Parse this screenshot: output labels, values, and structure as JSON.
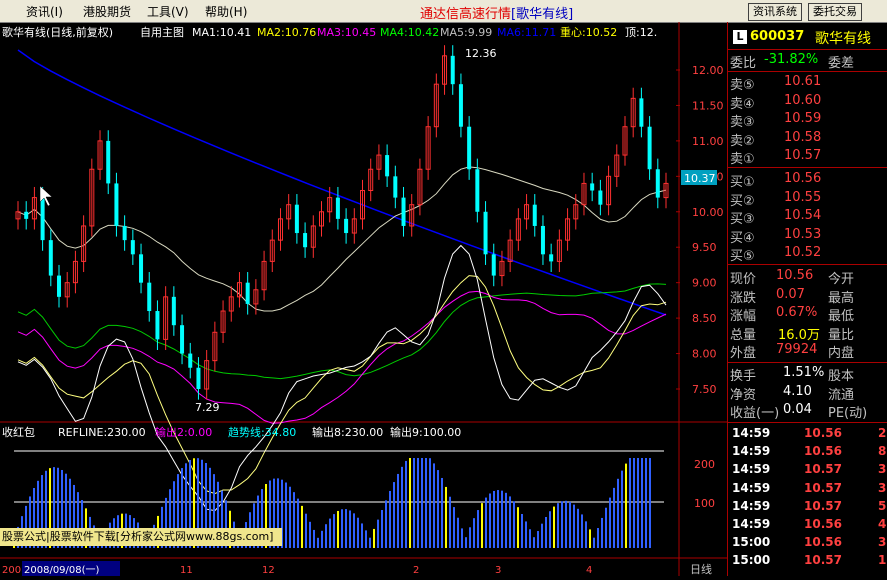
{
  "menu": {
    "items": [
      "资讯(I)",
      "港股期货",
      "工具(V)",
      "帮助(H)"
    ],
    "title": "通达信高速行情",
    "subtitle": "[歌华有线]",
    "btn_news": "资讯系统",
    "btn_trade": "委托交易"
  },
  "main_chart": {
    "header": [
      "歌华有线(日线,前复权)",
      "自用主图",
      "MA1:10.41",
      "MA2:10.76",
      "MA3:10.45",
      "MA4:10.42",
      "MA5:9.99",
      "MA6:11.71",
      "重心:10.52",
      "顶:12."
    ],
    "header_colors": [
      "#ffffff",
      "#ffffff",
      "#ffffff",
      "#ffff00",
      "#ff00ff",
      "#00ff00",
      "#c0c0c0",
      "#0000ff",
      "#ffff00",
      "#ffffff"
    ],
    "price_labels": [
      "12.00",
      "11.50",
      "11.00",
      "10.50",
      "10.00",
      "9.50",
      "9.00",
      "8.50",
      "8.00",
      "7.50"
    ],
    "high_label": "12.36",
    "low_label": "7.29",
    "current_price_tag": "10.37"
  },
  "chart_data": {
    "type": "candlestick",
    "yaxis_labels": [
      12.0,
      11.5,
      11.0,
      10.5,
      10.0,
      9.5,
      9.0,
      8.5,
      8.0,
      7.5
    ],
    "high": 12.36,
    "low": 7.29,
    "last_close": 10.37,
    "closes": [
      10.0,
      9.9,
      10.2,
      9.6,
      9.1,
      8.8,
      9.0,
      9.3,
      9.8,
      10.6,
      11.0,
      10.4,
      9.8,
      9.6,
      9.4,
      9.0,
      8.6,
      8.2,
      8.8,
      8.4,
      8.0,
      7.8,
      7.5,
      7.9,
      8.3,
      8.6,
      8.8,
      9.0,
      8.7,
      8.9,
      9.3,
      9.6,
      9.9,
      10.1,
      9.7,
      9.5,
      9.8,
      10.0,
      10.2,
      9.9,
      9.7,
      9.9,
      10.3,
      10.6,
      10.8,
      10.5,
      10.2,
      9.8,
      10.1,
      10.6,
      11.2,
      11.8,
      12.2,
      11.8,
      11.2,
      10.6,
      10.0,
      9.4,
      9.1,
      9.3,
      9.6,
      9.9,
      10.1,
      9.8,
      9.4,
      9.3,
      9.6,
      9.9,
      10.1,
      10.4,
      10.3,
      10.1,
      10.5,
      10.8,
      11.2,
      11.6,
      11.2,
      10.6,
      10.2,
      10.4
    ],
    "indicator": {
      "title": "收红包",
      "refline": "REFLINE:230.00",
      "out2": "输出2:0.00",
      "trend": "趋势线:34.80",
      "out8": "输出8:230.00",
      "out9": "输出9:100.00",
      "axis": [
        200.0,
        100.0
      ]
    }
  },
  "bottom": {
    "label_200": "200",
    "date": "2008/09/08(一)",
    "ticks": [
      "11",
      "12",
      "2",
      "3",
      "4"
    ],
    "period": "日线"
  },
  "quote": {
    "code": "600037",
    "name": "歌华有线",
    "weibi_label": "委比",
    "weibi_value": "-31.82%",
    "weicha_label": "委差",
    "sell": [
      {
        "label": "卖⑤",
        "price": "10.61"
      },
      {
        "label": "卖④",
        "price": "10.60"
      },
      {
        "label": "卖③",
        "price": "10.59"
      },
      {
        "label": "卖②",
        "price": "10.58"
      },
      {
        "label": "卖①",
        "price": "10.57"
      }
    ],
    "buy": [
      {
        "label": "买①",
        "price": "10.56"
      },
      {
        "label": "买②",
        "price": "10.55"
      },
      {
        "label": "买③",
        "price": "10.54"
      },
      {
        "label": "买④",
        "price": "10.53"
      },
      {
        "label": "买⑤",
        "price": "10.52"
      }
    ],
    "stats": [
      {
        "label": "现价",
        "value": "10.56",
        "label2": "今开"
      },
      {
        "label": "涨跌",
        "value": "0.07",
        "label2": "最高"
      },
      {
        "label": "涨幅",
        "value": "0.67%",
        "label2": "最低"
      },
      {
        "label": "总量",
        "value": "16.0万",
        "label2": "量比"
      },
      {
        "label": "外盘",
        "value": "79924",
        "label2": "内盘"
      }
    ],
    "stats2": [
      {
        "label": "换手",
        "value": "1.51%",
        "label2": "股本"
      },
      {
        "label": "净资",
        "value": "4.10",
        "label2": "流通"
      },
      {
        "label": "收益(一)",
        "value": "0.04",
        "label2": "PE(动)"
      }
    ],
    "ticks": [
      {
        "time": "14:59",
        "price": "10.56",
        "vol": "2"
      },
      {
        "time": "14:59",
        "price": "10.56",
        "vol": "8"
      },
      {
        "time": "14:59",
        "price": "10.57",
        "vol": "3"
      },
      {
        "time": "14:59",
        "price": "10.57",
        "vol": "3"
      },
      {
        "time": "14:59",
        "price": "10.57",
        "vol": "5"
      },
      {
        "time": "14:59",
        "price": "10.56",
        "vol": "4"
      },
      {
        "time": "15:00",
        "price": "10.56",
        "vol": "3"
      },
      {
        "time": "15:00",
        "price": "10.57",
        "vol": "1"
      }
    ]
  },
  "watermark": "股票公式|股票软件下载[分析家公式网www.88gs.com]"
}
